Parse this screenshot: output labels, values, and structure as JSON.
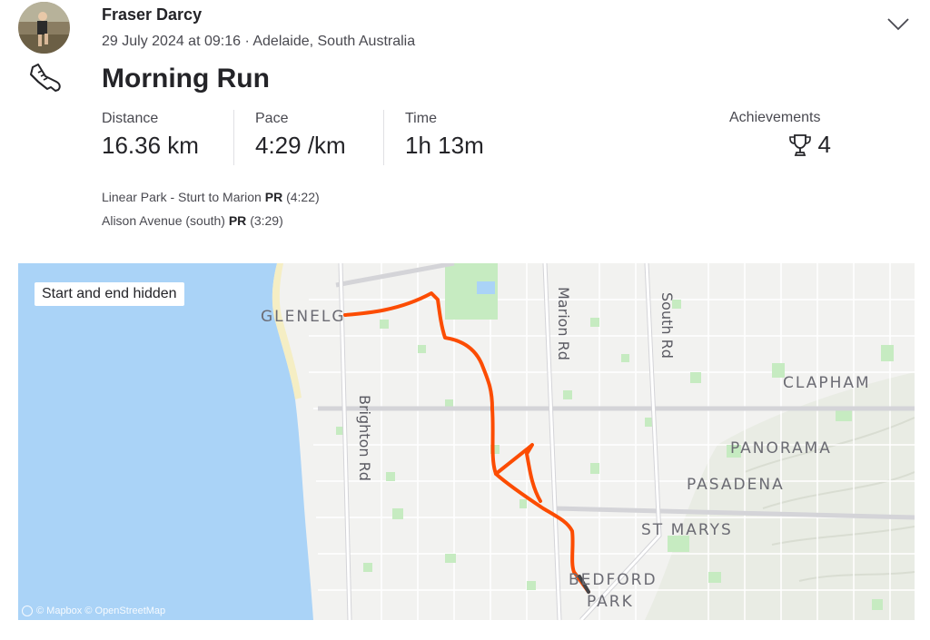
{
  "athlete": {
    "name": "Fraser Darcy",
    "date_location": "29 July 2024 at 09:16 · Adelaide, South Australia"
  },
  "activity": {
    "title": "Morning Run",
    "sport_icon": "running-shoe-icon"
  },
  "stats": [
    {
      "label": "Distance",
      "value": "16.36 km"
    },
    {
      "label": "Pace",
      "value": "4:29 /km"
    },
    {
      "label": "Time",
      "value": "1h 13m"
    }
  ],
  "achievements": {
    "label": "Achievements",
    "count": "4",
    "icon": "trophy-icon"
  },
  "segments": [
    {
      "name": "Linear Park - Sturt to Marion",
      "badge": "PR",
      "time": "(4:22)"
    },
    {
      "name": "Alison Avenue (south)",
      "badge": "PR",
      "time": "(3:29)"
    }
  ],
  "map": {
    "privacy_badge": "Start and end hidden",
    "attribution": "© Mapbox © OpenStreetMap",
    "suburbs": [
      "GLENELG",
      "CLAPHAM",
      "PANORAMA",
      "PASADENA",
      "ST MARYS",
      "BEDFORD",
      "PARK"
    ],
    "roads": [
      "Marion Rd",
      "South Rd",
      "Brighton Rd"
    ],
    "route_color": "#fc4c02",
    "water_color": "#aad3f7"
  }
}
